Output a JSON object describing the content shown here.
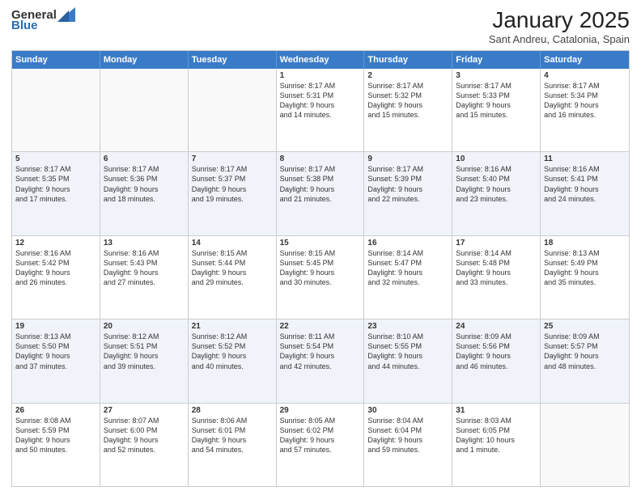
{
  "header": {
    "logo_general": "General",
    "logo_blue": "Blue",
    "title": "January 2025",
    "location": "Sant Andreu, Catalonia, Spain"
  },
  "weekdays": [
    "Sunday",
    "Monday",
    "Tuesday",
    "Wednesday",
    "Thursday",
    "Friday",
    "Saturday"
  ],
  "rows": [
    [
      {
        "day": "",
        "info": ""
      },
      {
        "day": "",
        "info": ""
      },
      {
        "day": "",
        "info": ""
      },
      {
        "day": "1",
        "info": "Sunrise: 8:17 AM\nSunset: 5:31 PM\nDaylight: 9 hours\nand 14 minutes."
      },
      {
        "day": "2",
        "info": "Sunrise: 8:17 AM\nSunset: 5:32 PM\nDaylight: 9 hours\nand 15 minutes."
      },
      {
        "day": "3",
        "info": "Sunrise: 8:17 AM\nSunset: 5:33 PM\nDaylight: 9 hours\nand 15 minutes."
      },
      {
        "day": "4",
        "info": "Sunrise: 8:17 AM\nSunset: 5:34 PM\nDaylight: 9 hours\nand 16 minutes."
      }
    ],
    [
      {
        "day": "5",
        "info": "Sunrise: 8:17 AM\nSunset: 5:35 PM\nDaylight: 9 hours\nand 17 minutes."
      },
      {
        "day": "6",
        "info": "Sunrise: 8:17 AM\nSunset: 5:36 PM\nDaylight: 9 hours\nand 18 minutes."
      },
      {
        "day": "7",
        "info": "Sunrise: 8:17 AM\nSunset: 5:37 PM\nDaylight: 9 hours\nand 19 minutes."
      },
      {
        "day": "8",
        "info": "Sunrise: 8:17 AM\nSunset: 5:38 PM\nDaylight: 9 hours\nand 21 minutes."
      },
      {
        "day": "9",
        "info": "Sunrise: 8:17 AM\nSunset: 5:39 PM\nDaylight: 9 hours\nand 22 minutes."
      },
      {
        "day": "10",
        "info": "Sunrise: 8:16 AM\nSunset: 5:40 PM\nDaylight: 9 hours\nand 23 minutes."
      },
      {
        "day": "11",
        "info": "Sunrise: 8:16 AM\nSunset: 5:41 PM\nDaylight: 9 hours\nand 24 minutes."
      }
    ],
    [
      {
        "day": "12",
        "info": "Sunrise: 8:16 AM\nSunset: 5:42 PM\nDaylight: 9 hours\nand 26 minutes."
      },
      {
        "day": "13",
        "info": "Sunrise: 8:16 AM\nSunset: 5:43 PM\nDaylight: 9 hours\nand 27 minutes."
      },
      {
        "day": "14",
        "info": "Sunrise: 8:15 AM\nSunset: 5:44 PM\nDaylight: 9 hours\nand 29 minutes."
      },
      {
        "day": "15",
        "info": "Sunrise: 8:15 AM\nSunset: 5:45 PM\nDaylight: 9 hours\nand 30 minutes."
      },
      {
        "day": "16",
        "info": "Sunrise: 8:14 AM\nSunset: 5:47 PM\nDaylight: 9 hours\nand 32 minutes."
      },
      {
        "day": "17",
        "info": "Sunrise: 8:14 AM\nSunset: 5:48 PM\nDaylight: 9 hours\nand 33 minutes."
      },
      {
        "day": "18",
        "info": "Sunrise: 8:13 AM\nSunset: 5:49 PM\nDaylight: 9 hours\nand 35 minutes."
      }
    ],
    [
      {
        "day": "19",
        "info": "Sunrise: 8:13 AM\nSunset: 5:50 PM\nDaylight: 9 hours\nand 37 minutes."
      },
      {
        "day": "20",
        "info": "Sunrise: 8:12 AM\nSunset: 5:51 PM\nDaylight: 9 hours\nand 39 minutes."
      },
      {
        "day": "21",
        "info": "Sunrise: 8:12 AM\nSunset: 5:52 PM\nDaylight: 9 hours\nand 40 minutes."
      },
      {
        "day": "22",
        "info": "Sunrise: 8:11 AM\nSunset: 5:54 PM\nDaylight: 9 hours\nand 42 minutes."
      },
      {
        "day": "23",
        "info": "Sunrise: 8:10 AM\nSunset: 5:55 PM\nDaylight: 9 hours\nand 44 minutes."
      },
      {
        "day": "24",
        "info": "Sunrise: 8:09 AM\nSunset: 5:56 PM\nDaylight: 9 hours\nand 46 minutes."
      },
      {
        "day": "25",
        "info": "Sunrise: 8:09 AM\nSunset: 5:57 PM\nDaylight: 9 hours\nand 48 minutes."
      }
    ],
    [
      {
        "day": "26",
        "info": "Sunrise: 8:08 AM\nSunset: 5:59 PM\nDaylight: 9 hours\nand 50 minutes."
      },
      {
        "day": "27",
        "info": "Sunrise: 8:07 AM\nSunset: 6:00 PM\nDaylight: 9 hours\nand 52 minutes."
      },
      {
        "day": "28",
        "info": "Sunrise: 8:06 AM\nSunset: 6:01 PM\nDaylight: 9 hours\nand 54 minutes."
      },
      {
        "day": "29",
        "info": "Sunrise: 8:05 AM\nSunset: 6:02 PM\nDaylight: 9 hours\nand 57 minutes."
      },
      {
        "day": "30",
        "info": "Sunrise: 8:04 AM\nSunset: 6:04 PM\nDaylight: 9 hours\nand 59 minutes."
      },
      {
        "day": "31",
        "info": "Sunrise: 8:03 AM\nSunset: 6:05 PM\nDaylight: 10 hours\nand 1 minute."
      },
      {
        "day": "",
        "info": ""
      }
    ]
  ],
  "alt_rows": [
    1,
    3
  ]
}
